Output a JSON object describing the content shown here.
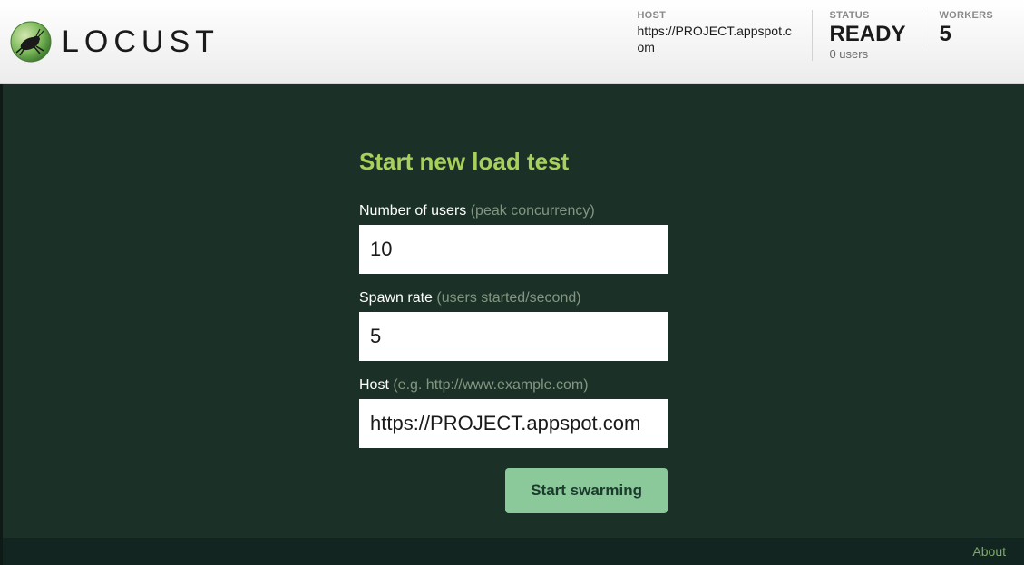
{
  "app": {
    "name": "LOCUST"
  },
  "header": {
    "host": {
      "label": "HOST",
      "value": "https://PROJECT.appspot.com"
    },
    "status": {
      "label": "STATUS",
      "value": "READY",
      "sub": "0 users"
    },
    "workers": {
      "label": "WORKERS",
      "value": "5"
    }
  },
  "form": {
    "title": "Start new load test",
    "users": {
      "label": "Number of users ",
      "hint": "(peak concurrency)",
      "value": "10"
    },
    "spawn": {
      "label": "Spawn rate ",
      "hint": "(users started/second)",
      "value": "5"
    },
    "host": {
      "label": "Host ",
      "hint": "(e.g. http://www.example.com)",
      "value": "https://PROJECT.appspot.com"
    },
    "submit": "Start swarming"
  },
  "footer": {
    "about": "About"
  }
}
